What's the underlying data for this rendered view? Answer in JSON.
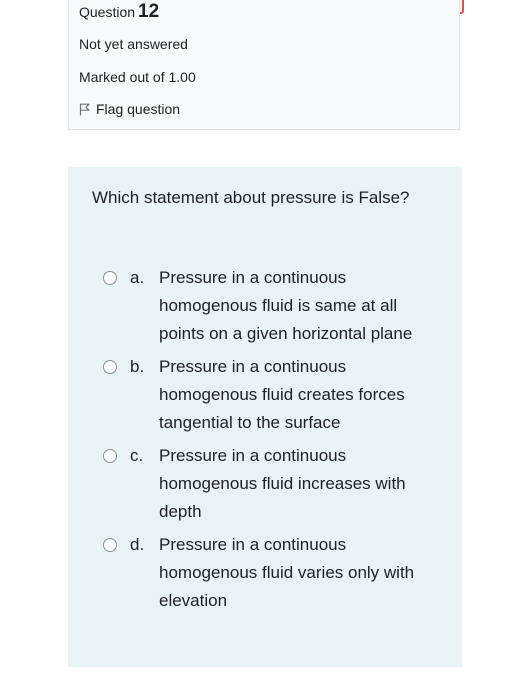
{
  "question_info": {
    "heading_prefix": "Question",
    "number": "12",
    "status": "Not yet answered",
    "marks": "Marked out of 1.00",
    "flag_label": "Flag question"
  },
  "question": {
    "text": "Which statement about pressure is False?",
    "options": [
      {
        "letter": "a.",
        "text": "Pressure in a continuous homogenous fluid is same at all points on a given horizontal plane"
      },
      {
        "letter": "b.",
        "text": "Pressure in a continuous homogenous fluid creates forces tangential to the surface"
      },
      {
        "letter": "c.",
        "text": "Pressure in a continuous homogenous fluid increases with depth"
      },
      {
        "letter": "d.",
        "text": "Pressure in a continuous homogenous fluid varies only with elevation"
      }
    ]
  },
  "icons": {
    "flag": "flag-icon"
  },
  "colors": {
    "content_bg": "#e7f3f5",
    "info_bg": "#f8f9fa",
    "timer_border": "#d9534f"
  }
}
